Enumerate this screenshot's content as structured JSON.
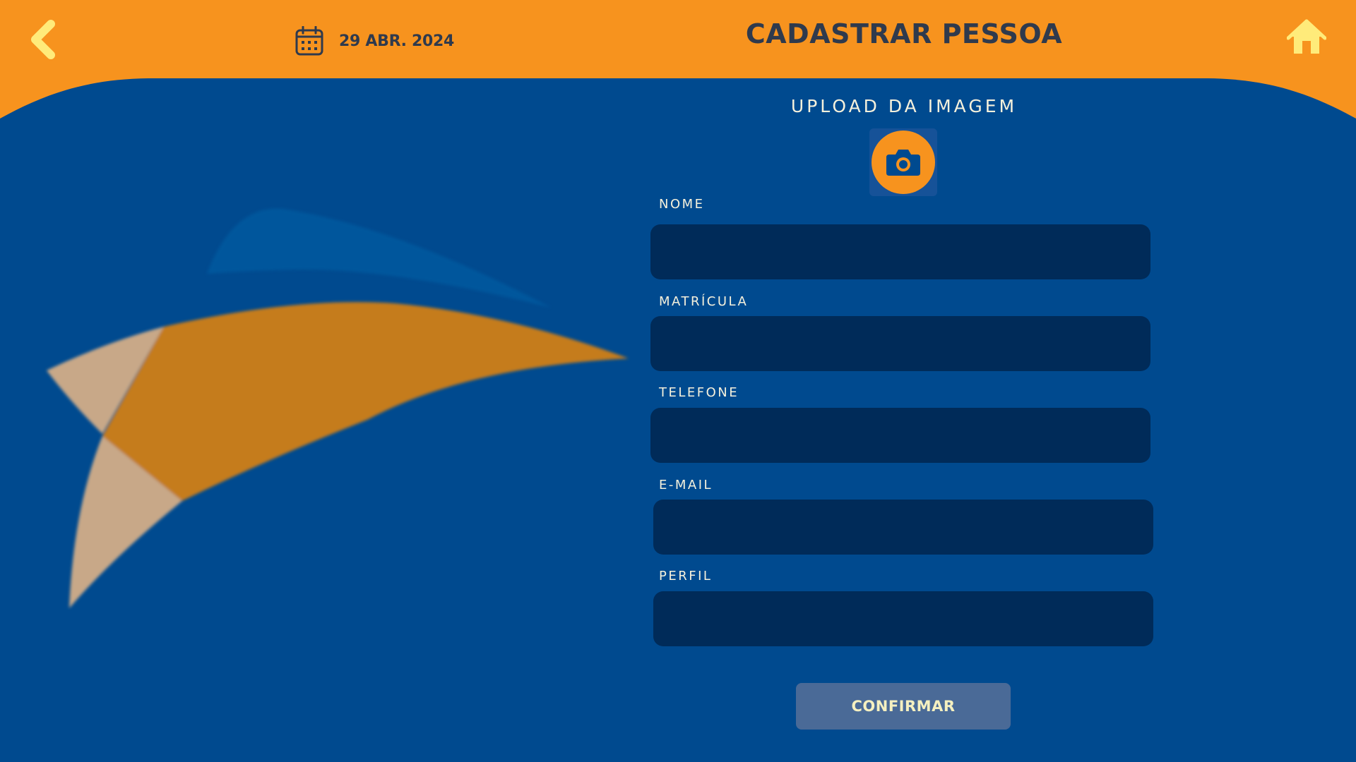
{
  "header": {
    "back_icon": "chevron-left-icon",
    "date_icon": "calendar-icon",
    "date": "29 ABR. 2024",
    "title": "CADASTRAR PESSOA",
    "home_icon": "home-icon"
  },
  "upload": {
    "label": "UPLOAD DA IMAGEM",
    "icon": "camera-icon"
  },
  "form": {
    "fields": [
      {
        "label": "NOME",
        "value": ""
      },
      {
        "label": "MATRÍCULA",
        "value": ""
      },
      {
        "label": "TELEFONE",
        "value": ""
      },
      {
        "label": "E-MAIL",
        "value": ""
      },
      {
        "label": "PERFIL",
        "value": ""
      }
    ],
    "confirm_label": "CONFIRMAR"
  },
  "colors": {
    "header_orange": "#f7931e",
    "main_blue": "#004a8f",
    "input_navy": "#002b59",
    "title_text": "#2f3a4d",
    "accent_yellow": "#ffeb7a"
  }
}
